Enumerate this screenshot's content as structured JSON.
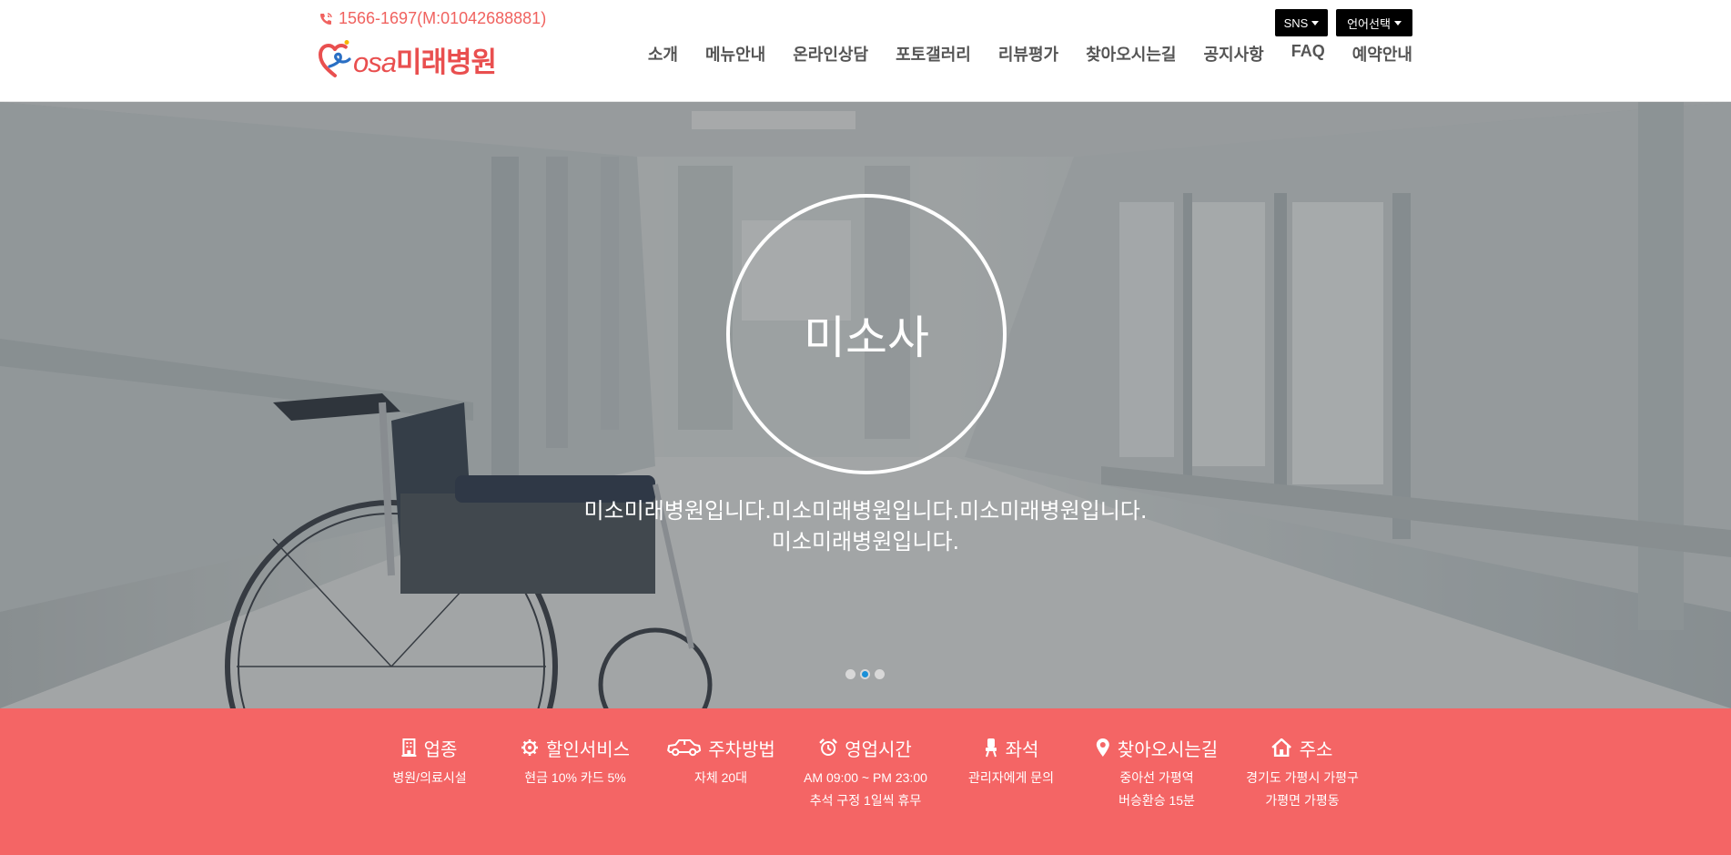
{
  "header": {
    "phone": "1566-1697(M:01042688881)",
    "logo": {
      "prefix": "osa",
      "name": "미래병원"
    },
    "sns_label": "SNS",
    "language_label": "언어선택",
    "nav": [
      "소개",
      "메뉴안내",
      "온라인상담",
      "포토갤러리",
      "리뷰평가",
      "찾아오시는길",
      "공지사항",
      "FAQ",
      "예약안내"
    ]
  },
  "hero": {
    "title": "미소사",
    "text_line1": "미소미래병원입니다.미소미래병원입니다.미소미래병원입니다.",
    "text_line2": "미소미래병원입니다.",
    "slide_count": 3,
    "active_slide": 2
  },
  "info": [
    {
      "icon": "building-icon",
      "title": "업종",
      "lines": [
        "병원/의료시설"
      ]
    },
    {
      "icon": "settings-cog-icon",
      "title": "할인서비스",
      "lines": [
        "현금 10% 카드 5%"
      ]
    },
    {
      "icon": "car-icon",
      "title": "주차방법",
      "lines": [
        "자체 20대"
      ]
    },
    {
      "icon": "alarm-clock-icon",
      "title": "영업시간",
      "lines": [
        "AM 09:00 ~ PM 23:00",
        "추석 구정 1일씩 휴무"
      ]
    },
    {
      "icon": "seat-icon",
      "title": "좌석",
      "lines": [
        "관리자에게 문의"
      ]
    },
    {
      "icon": "map-pin-icon",
      "title": "찾아오시는길",
      "lines": [
        "중아선 가평역",
        "버승환승 15분"
      ]
    },
    {
      "icon": "home-icon",
      "title": "주소",
      "lines": [
        "경기도 가평시 가평구",
        "가평면 가평동"
      ]
    }
  ],
  "colors": {
    "accent": "#f46565",
    "phone": "#f0625f",
    "dot_active": "#1a90d8"
  }
}
